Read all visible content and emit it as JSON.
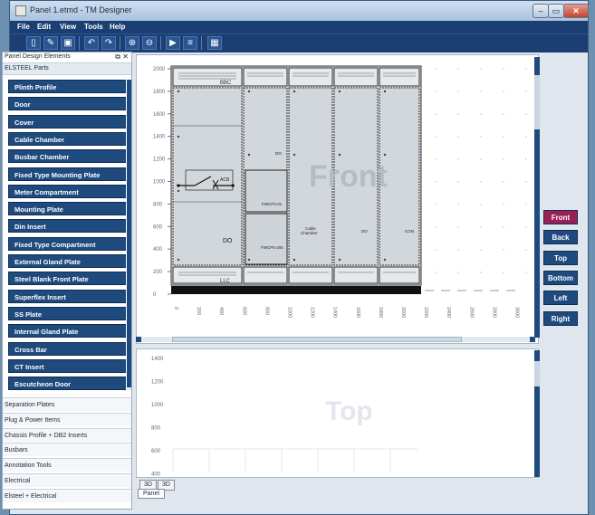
{
  "window": {
    "title": "Panel 1.etmd - TM Designer"
  },
  "menu": [
    "File",
    "Edit",
    "View",
    "Tools",
    "Help"
  ],
  "left_panel": {
    "title": "Panel Design Elements",
    "section": "ELSTEEL Parts",
    "parts": [
      "Plinth Profile",
      "Door",
      "Cover",
      "Cable Chamber",
      "Busbar Chamber",
      "Fixed Type Mounting Plate",
      "Meter Compartment",
      "Mounting Plate",
      "Din Insert",
      "Fixed Type Compartment",
      "External Gland Plate",
      "Steel Blank Front Plate",
      "Superflex Insert",
      "SS Plate",
      "Internal Gland Plate",
      "Cross Bar",
      "CT Insert",
      "Escutcheon Door"
    ],
    "categories": [
      "Separation Plates",
      "Plug & Power Items",
      "Chassis Profile + DB2 Inserts",
      "Busbars",
      "Annotation Tools",
      "Electrical",
      "Elsteel + Electrical"
    ]
  },
  "front_view": {
    "watermark": "Front",
    "y_ticks": [
      "2000",
      "1800",
      "1600",
      "1400",
      "1200",
      "1000",
      "800",
      "600",
      "400",
      "200",
      "0"
    ],
    "x_ticks": [
      "0",
      "200",
      "400",
      "600",
      "800",
      "1000",
      "1200",
      "1400",
      "1600",
      "1800",
      "2000",
      "2200",
      "2400",
      "2600",
      "2800",
      "3000"
    ],
    "labels": {
      "bbc": "BBC",
      "llc": "LLC",
      "do": "DO",
      "do_small": "DO",
      "do2": "DO",
      "con": "CON",
      "cable_chamber": "Cable\nChamber",
      "fwcp_top": "FWCP4-01",
      "fwcp_bot": "FWCP5-205",
      "aca": "ACB"
    }
  },
  "top_view": {
    "watermark": "Top",
    "y_ticks": [
      "1400",
      "1200",
      "1000",
      "800",
      "600",
      "400"
    ]
  },
  "view_buttons": [
    "Front",
    "Back",
    "Top",
    "Bottom",
    "Left",
    "Right"
  ],
  "active_view": "Front",
  "tabs": [
    "3D",
    "3D"
  ],
  "bottom_tab": "Panel",
  "colors": {
    "accent": "#1f4a7e",
    "active": "#9a1f55",
    "menubar": "#1b3f72"
  }
}
